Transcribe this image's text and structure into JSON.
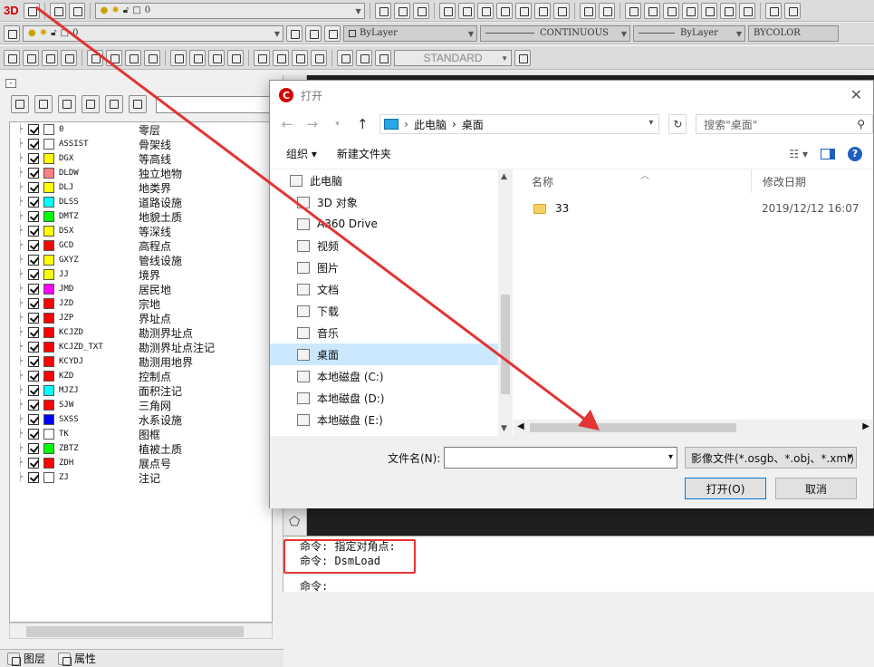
{
  "toolbar1": {
    "logo": "3D",
    "layer_value": "0"
  },
  "toolbar2": {
    "layer_value": "0",
    "color": "ByLayer",
    "linetype": "CONTINUOUS",
    "lineweight": "ByLayer",
    "plotstyle": "BYCOLOR"
  },
  "toolbar3": {
    "textstyle": "STANDARD"
  },
  "layers": [
    {
      "name": "0",
      "desc": "零层",
      "color": "#ffffff"
    },
    {
      "name": "ASSIST",
      "desc": "骨架线",
      "color": "#ffffff"
    },
    {
      "name": "DGX",
      "desc": "等高线",
      "color": "#ffff00"
    },
    {
      "name": "DLDW",
      "desc": "独立地物",
      "color": "#ff8080"
    },
    {
      "name": "DLJ",
      "desc": "地类界",
      "color": "#ffff00"
    },
    {
      "name": "DLSS",
      "desc": "道路设施",
      "color": "#00ffff"
    },
    {
      "name": "DMTZ",
      "desc": "地貌土质",
      "color": "#00ff00"
    },
    {
      "name": "DSX",
      "desc": "等深线",
      "color": "#ffff00"
    },
    {
      "name": "GCD",
      "desc": "高程点",
      "color": "#ff0000"
    },
    {
      "name": "GXYZ",
      "desc": "管线设施",
      "color": "#ffff00"
    },
    {
      "name": "JJ",
      "desc": "境界",
      "color": "#ffff00"
    },
    {
      "name": "JMD",
      "desc": "居民地",
      "color": "#ff00ff"
    },
    {
      "name": "JZD",
      "desc": "宗地",
      "color": "#ff0000"
    },
    {
      "name": "JZP",
      "desc": "界址点",
      "color": "#ff0000"
    },
    {
      "name": "KCJZD",
      "desc": "勘测界址点",
      "color": "#ff0000"
    },
    {
      "name": "KCJZD_TXT",
      "desc": "勘测界址点注记",
      "color": "#ff0000"
    },
    {
      "name": "KCYDJ",
      "desc": "勘测用地界",
      "color": "#ff0000"
    },
    {
      "name": "KZD",
      "desc": "控制点",
      "color": "#ff0000"
    },
    {
      "name": "MJZJ",
      "desc": "面积注记",
      "color": "#00ffff"
    },
    {
      "name": "SJW",
      "desc": "三角网",
      "color": "#ff0000"
    },
    {
      "name": "SXSS",
      "desc": "水系设施",
      "color": "#0000ff"
    },
    {
      "name": "TK",
      "desc": "图框",
      "color": "#ffffff"
    },
    {
      "name": "ZBTZ",
      "desc": "植被土质",
      "color": "#00ff00"
    },
    {
      "name": "ZDH",
      "desc": "展点号",
      "color": "#ff0000"
    },
    {
      "name": "ZJ",
      "desc": "注记",
      "color": "#ffffff"
    }
  ],
  "left_tabs": {
    "layers": "图层",
    "properties": "属性"
  },
  "command": {
    "line1": "命令: 指定对角点:",
    "line2": "命令: DsmLoad",
    "line3": "命令:"
  },
  "dialog": {
    "title": "打开",
    "path": {
      "root": "此电脑",
      "sep": "›",
      "current": "桌面"
    },
    "search_placeholder": "搜索\"桌面\"",
    "organize": "组织 ▾",
    "new_folder": "新建文件夹",
    "nav": [
      {
        "label": "此电脑",
        "indent": 0
      },
      {
        "label": "3D 对象",
        "indent": 1
      },
      {
        "label": "A360 Drive",
        "indent": 1
      },
      {
        "label": "视频",
        "indent": 1
      },
      {
        "label": "图片",
        "indent": 1
      },
      {
        "label": "文档",
        "indent": 1
      },
      {
        "label": "下载",
        "indent": 1
      },
      {
        "label": "音乐",
        "indent": 1
      },
      {
        "label": "桌面",
        "indent": 1,
        "selected": true
      },
      {
        "label": "本地磁盘 (C:)",
        "indent": 1
      },
      {
        "label": "本地磁盘 (D:)",
        "indent": 1
      },
      {
        "label": "本地磁盘 (E:)",
        "indent": 1
      }
    ],
    "columns": {
      "name": "名称",
      "date": "修改日期"
    },
    "files": [
      {
        "name": "33",
        "date": "2019/12/12 16:07"
      }
    ],
    "filename_label": "文件名(N):",
    "filename_value": "",
    "filetype": "影像文件(*.osgb、*.obj、*.xml)",
    "open_button": "打开(O)",
    "cancel_button": "取消"
  },
  "colors": {
    "accent": "#0078d7",
    "highlight": "#e33333",
    "selection": "#cce8ff"
  }
}
